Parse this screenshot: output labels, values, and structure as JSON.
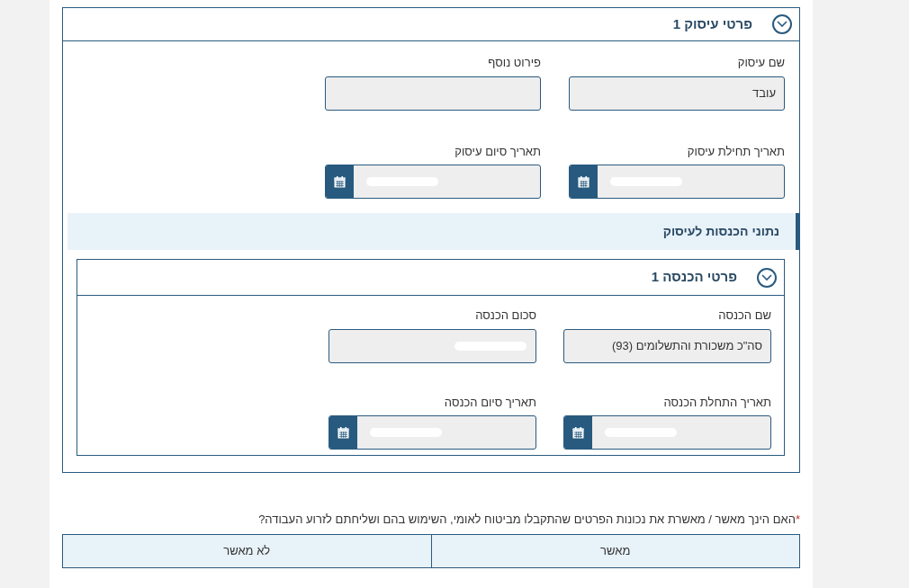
{
  "employment_section": {
    "title": "פרטי עיסוק 1",
    "expanded": true,
    "fields": [
      {
        "label": "שם עיסוק",
        "kind": "text",
        "value": "עובד"
      },
      {
        "label": "פירוט נוסף",
        "kind": "text"
      },
      {
        "label": "תאריך תחילת עיסוק",
        "kind": "date",
        "redacted": true
      },
      {
        "label": "תאריך סיום עיסוק",
        "kind": "date",
        "redacted": true
      }
    ],
    "income_header": "נתוני הכנסות לעיסוק",
    "income_section": {
      "title": "פרטי הכנסה 1",
      "expanded": true,
      "fields": [
        {
          "label": "שם הכנסה",
          "kind": "text",
          "value": "סה\"כ משכורת והתשלומים (93)"
        },
        {
          "label": "סכום הכנסה",
          "kind": "text",
          "redacted": true
        },
        {
          "label": "תאריך התחלת הכנסה",
          "kind": "date",
          "redacted": true
        },
        {
          "label": "תאריך סיום הכנסה",
          "kind": "date",
          "redacted": true
        }
      ]
    }
  },
  "question": {
    "required_mark": "*",
    "text": "האם הינך מאשר / מאשרת את נכונות הפרטים שהתקבלו מביטוח לאומי, השימוש בהם ושליחתם לזרוע העבודה?",
    "options": [
      {
        "label": "מאשר",
        "selected": false
      },
      {
        "label": "לא מאשר",
        "selected": false
      }
    ]
  }
}
